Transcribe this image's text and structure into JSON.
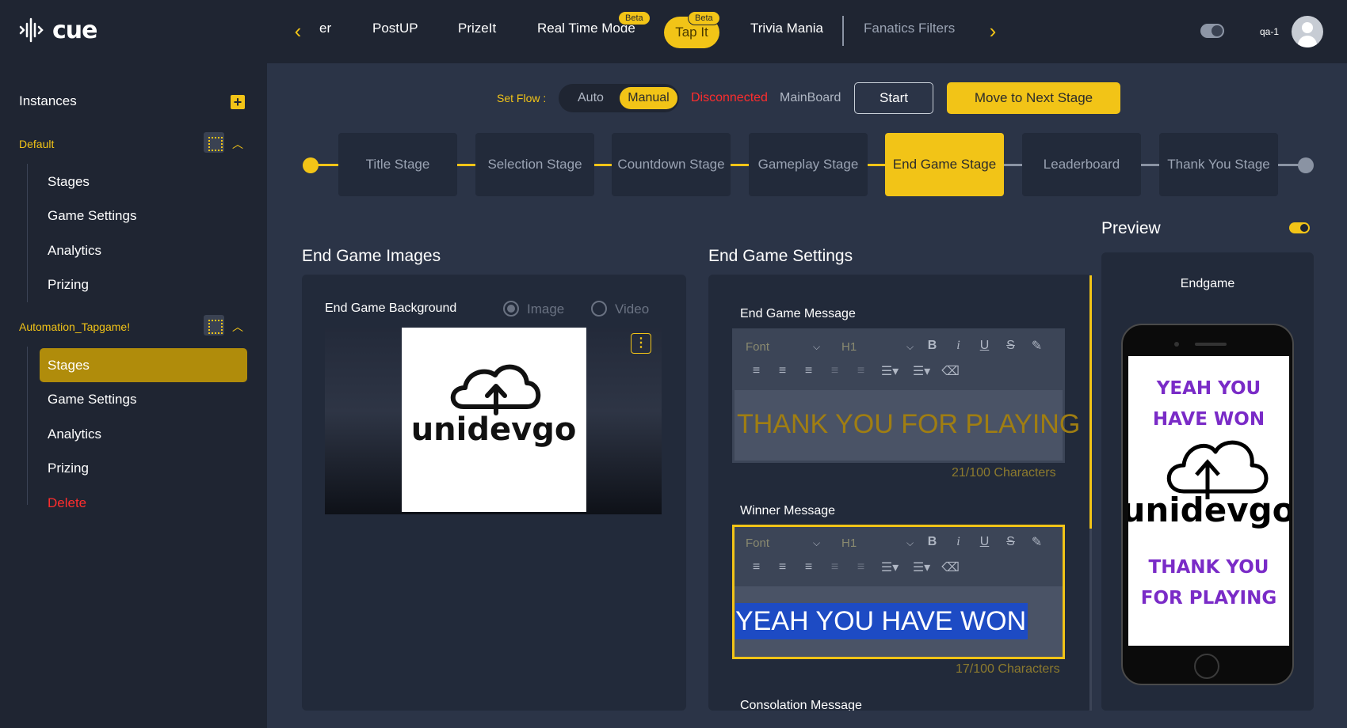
{
  "brand": {
    "name": "cue",
    "accent": "#f2c417",
    "danger": "#ff2d2d"
  },
  "topnav": {
    "tabs": [
      {
        "label": "er"
      },
      {
        "label": "PostUP"
      },
      {
        "label": "PrizeIt"
      },
      {
        "label": "Real Time Mode",
        "badge": "Beta"
      },
      {
        "label": "Tap It",
        "badge": "Beta",
        "active": true
      },
      {
        "label": "Trivia Mania"
      },
      {
        "label": "Fanatics Filters"
      }
    ],
    "user": "qa-1"
  },
  "sidebar": {
    "title": "Instances",
    "groups": [
      {
        "name": "Default",
        "items": [
          "Stages",
          "Game Settings",
          "Analytics",
          "Prizing"
        ]
      },
      {
        "name": "Automation_Tapgame!",
        "items": [
          "Stages",
          "Game Settings",
          "Analytics",
          "Prizing",
          "Delete"
        ],
        "active_item": "Stages"
      }
    ]
  },
  "flow": {
    "label": "Set Flow :",
    "options": [
      "Auto",
      "Manual"
    ],
    "selected": "Manual",
    "status": "Disconnected",
    "board": "MainBoard",
    "start": "Start",
    "next": "Move to Next Stage"
  },
  "stages": [
    "Title Stage",
    "Selection Stage",
    "Countdown Stage",
    "Gameplay Stage",
    "End Game Stage",
    "Leaderboard",
    "Thank You Stage"
  ],
  "active_stage": "End Game Stage",
  "images": {
    "title": "End Game Images",
    "background_label": "End Game Background",
    "media_options": [
      "Image",
      "Video"
    ],
    "media_selected": "Image",
    "logo_text": "unidevgo"
  },
  "settings": {
    "title": "End Game Settings",
    "toolbar": {
      "font": "Font",
      "heading": "H1"
    },
    "end_message": {
      "label": "End Game Message",
      "value": "THANK YOU FOR PLAYING",
      "count": "21/100 Characters"
    },
    "winner_message": {
      "label": "Winner Message",
      "value": "YEAH YOU HAVE WON",
      "count": "17/100 Characters"
    },
    "consolation_label": "Consolation Message"
  },
  "preview": {
    "title": "Preview",
    "screen_title": "Endgame",
    "top_text": [
      "YEAH YOU",
      "HAVE WON"
    ],
    "bottom_text": [
      "THANK YOU",
      "FOR PLAYING"
    ],
    "logo_text": "unidevgo"
  }
}
